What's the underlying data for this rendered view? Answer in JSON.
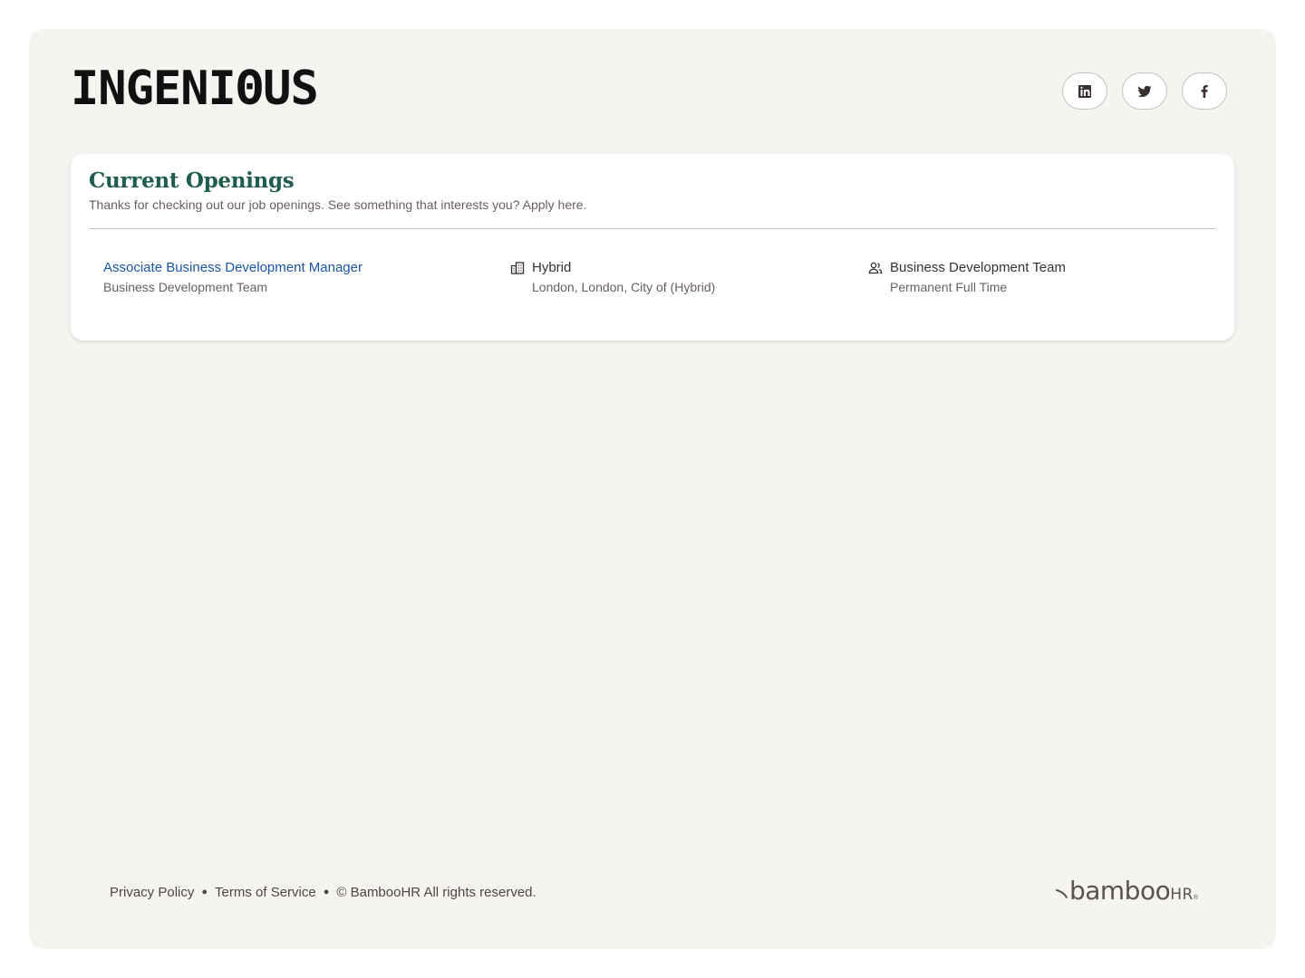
{
  "header": {
    "logo_text": "INGENIΘUS",
    "social": [
      {
        "name": "linkedin",
        "icon": "linkedin-icon"
      },
      {
        "name": "twitter",
        "icon": "twitter-icon"
      },
      {
        "name": "facebook",
        "icon": "facebook-icon"
      }
    ]
  },
  "openings": {
    "title": "Current Openings",
    "subtitle": "Thanks for checking out our job openings. See something that interests you? Apply here.",
    "jobs": [
      {
        "title": "Associate Business Development Manager",
        "department": "Business Development Team",
        "location_type": "Hybrid",
        "location": "London, London, City of (Hybrid)",
        "team": "Business Development Team",
        "employment_type": "Permanent Full Time"
      }
    ]
  },
  "footer": {
    "privacy": "Privacy Policy",
    "terms": "Terms of Service",
    "copyright": "© BambooHR All rights reserved.",
    "brand_main": "bamboo",
    "brand_hr": "HR",
    "brand_reg": "®"
  },
  "colors": {
    "page_bg": "#f5f4f1",
    "title_green": "#1e5c4f",
    "link_blue": "#1b56a6",
    "text_dark": "#38312f",
    "text_muted": "#68605d"
  }
}
